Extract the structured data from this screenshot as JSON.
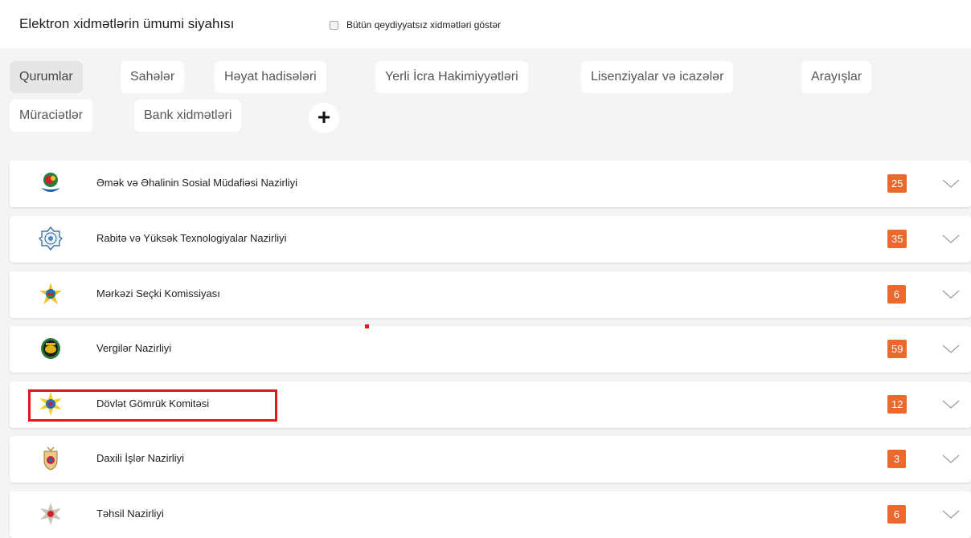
{
  "header": {
    "title": "Elektron xidmətlərin ümumi siyahısı",
    "show_unregistered_label": "Bütün qeydiyyatsız xidmətləri göstər"
  },
  "tabs": [
    {
      "label": "Qurumlar",
      "active": true
    },
    {
      "label": "Sahələr"
    },
    {
      "label": "Həyat hadisələri"
    },
    {
      "label": "Yerli İcra Hakimiyyətləri"
    },
    {
      "label": "Lisenziyalar və icazələr"
    },
    {
      "label": "Arayışlar"
    },
    {
      "label": "Müraciətlər"
    },
    {
      "label": "Bank xidmətləri"
    }
  ],
  "add_label": "+",
  "organizations": [
    {
      "name": "Əmək və Əhalinin Sosial Müdafiəsi Nazirliyi",
      "count": "25",
      "logo": "labor-ministry-logo-icon"
    },
    {
      "name": "Rabitə və Yüksək Texnologiyalar Nazirliyi",
      "count": "35",
      "logo": "communications-ministry-logo-icon"
    },
    {
      "name": "Mərkəzi Seçki Komissiyası",
      "count": "6",
      "logo": "election-commission-logo-icon"
    },
    {
      "name": "Vergilər Nazirliyi",
      "count": "59",
      "logo": "tax-ministry-logo-icon"
    },
    {
      "name": "Dövlət Gömrük Komitəsi",
      "count": "12",
      "logo": "customs-committee-logo-icon"
    },
    {
      "name": "Daxili İşlər Nazirliyi",
      "count": "3",
      "logo": "internal-affairs-logo-icon"
    },
    {
      "name": "Təhsil Nazirliyi",
      "count": "6",
      "logo": "education-ministry-logo-icon"
    }
  ],
  "colors": {
    "badge": "#ea6a2d",
    "highlight": "#e4141b"
  }
}
